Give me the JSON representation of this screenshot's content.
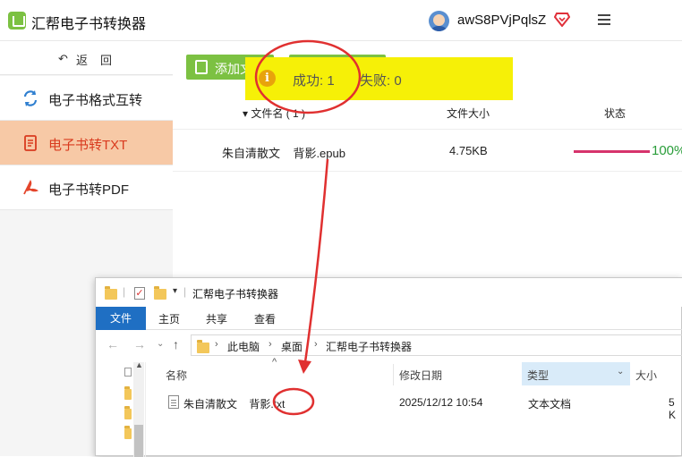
{
  "app": {
    "title": "汇帮电子书转换器",
    "username": "awS8PVjPqlsZ"
  },
  "sidebar": {
    "back_arrow": "↶",
    "back_label": "返回",
    "items": [
      {
        "label": "电子书格式互转",
        "icon": "convert-icon",
        "active": false
      },
      {
        "label": "电子书转TXT",
        "icon": "txt-doc-icon",
        "active": true
      },
      {
        "label": "电子书转PDF",
        "icon": "pdf-icon",
        "active": false
      }
    ]
  },
  "toolbar": {
    "add_label": "添加文"
  },
  "table": {
    "headers": {
      "name": "▾ 文件名 ( 1 )",
      "size": "文件大小",
      "status": "状态"
    },
    "rows": [
      {
        "name": "朱自清散文    背影.epub",
        "size": "4.75KB",
        "progress": 1.0,
        "percent": "100%"
      }
    ]
  },
  "toast": {
    "success": "成功:  1",
    "fail": "失败:  0"
  },
  "explorer": {
    "title": "汇帮电子书转换器",
    "ribbon_tabs": [
      "文件",
      "主页",
      "共享",
      "查看"
    ],
    "breadcrumbs": [
      "此电脑",
      "桌面",
      "汇帮电子书转换器"
    ],
    "columns": {
      "name": "名称",
      "date": "修改日期",
      "type": "类型",
      "size": "大小"
    },
    "files": [
      {
        "name": "朱自清散文    背影.txt",
        "date": "2025/12/12 10:54",
        "type": "文本文档",
        "size": "5 K"
      }
    ]
  },
  "colors": {
    "accent_green": "#7cc142",
    "active_nav_bg": "#f7c9a6",
    "active_nav_text": "#d93b1f",
    "toast_bg": "#f6f007",
    "progress": "#d6336c",
    "percent_text": "#2a9d3a",
    "annotation_red": "#e03030",
    "ribbon_blue": "#1f6fc3"
  }
}
